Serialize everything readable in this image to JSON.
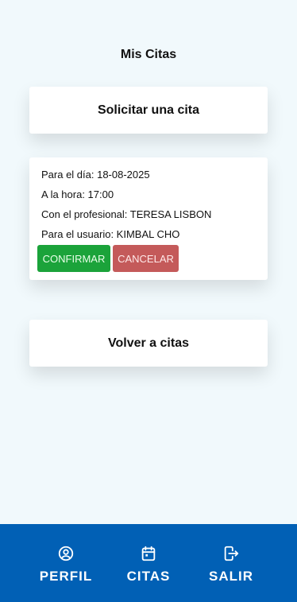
{
  "page": {
    "title": "Mis Citas"
  },
  "actions": {
    "request": "Solicitar una cita",
    "back": "Volver a citas"
  },
  "appointment": {
    "date": "Para el día: 18-08-2025",
    "time": "A la hora: 17:00",
    "professional": "Con el profesional: TERESA LISBON",
    "user": "Para el usuario: KIMBAL CHO",
    "confirm_label": "CONFIRMAR",
    "cancel_label": "CANCELAR"
  },
  "nav": {
    "items": [
      {
        "label": "PERFIL",
        "icon": "user-circle-icon"
      },
      {
        "label": "CITAS",
        "icon": "calendar-icon"
      },
      {
        "label": "SALIR",
        "icon": "logout-icon"
      }
    ]
  },
  "colors": {
    "background": "#f1f9fc",
    "nav": "#0160b5",
    "confirm": "#1ba33a",
    "cancel": "#c45a5a"
  }
}
